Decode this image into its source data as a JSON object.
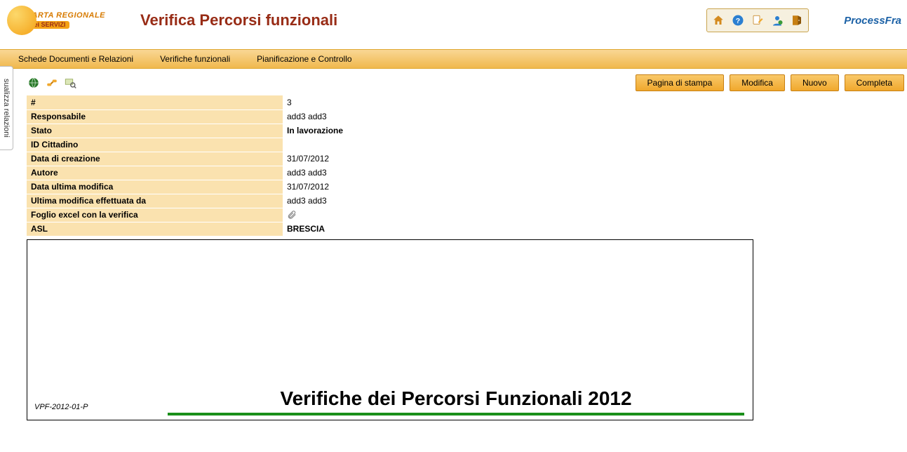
{
  "logo": {
    "line1": "CARTA REGIONALE",
    "line2": "dei SERVIZI"
  },
  "page_title": "Verifica Percorsi funzionali",
  "brand2": "ProcessFra",
  "menu": {
    "items": [
      "Schede Documenti e Relazioni",
      "Verifiche funzionali",
      "Pianificazione e Controllo"
    ]
  },
  "side_tab": "sualizza relazioni",
  "actions": {
    "print": "Pagina di stampa",
    "edit": "Modifica",
    "new": "Nuovo",
    "complete": "Completa"
  },
  "fields": {
    "num_label": "#",
    "num_value": "3",
    "resp_label": "Responsabile",
    "resp_value": "add3 add3",
    "stato_label": "Stato",
    "stato_value": "In lavorazione",
    "idcit_label": "ID Cittadino",
    "idcit_value": "",
    "datacreaz_label": "Data di creazione",
    "datacreaz_value": "31/07/2012",
    "autore_label": "Autore",
    "autore_value": "add3 add3",
    "datamod_label": "Data ultima modifica",
    "datamod_value": "31/07/2012",
    "ultmod_label": "Ultima modifica effettuata da",
    "ultmod_value": "add3 add3",
    "foglio_label": "Foglio excel con la verifica",
    "asl_label": "ASL",
    "asl_value": "BRESCIA"
  },
  "document": {
    "id": "VPF-2012-01-P",
    "title": "Verifiche dei Percorsi Funzionali 2012"
  }
}
